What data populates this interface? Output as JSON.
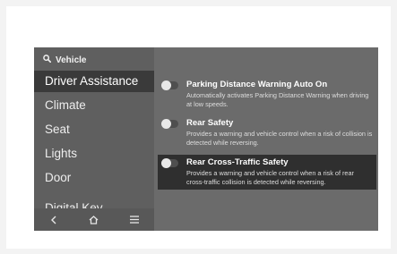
{
  "sidebar": {
    "header": {
      "icon": "search-icon",
      "label": "Vehicle"
    },
    "items": [
      {
        "label": "Driver Assistance",
        "active": true
      },
      {
        "label": "Climate"
      },
      {
        "label": "Seat"
      },
      {
        "label": "Lights"
      },
      {
        "label": "Door"
      },
      {
        "label": "Digital Key"
      }
    ],
    "bottom_bar": {
      "back_icon": "back-chevron-icon",
      "home_icon": "home-icon",
      "menu_icon": "menu-icon"
    }
  },
  "settings": [
    {
      "title": "Parking Distance Warning Auto On",
      "description": "Automatically activates Parking Distance Warning when driving at low speeds.",
      "enabled": false
    },
    {
      "title": "Rear Safety",
      "description": "Provides a warning and vehicle control when a risk of collision is detected while reversing.",
      "enabled": false
    },
    {
      "title": "Rear Cross-Traffic Safety",
      "description": "Provides a warning and vehicle control when a risk of rear cross-traffic collision is detected while reversing.",
      "enabled": false,
      "selected": true
    }
  ],
  "colors": {
    "screen_bg": "#6b6b6b",
    "sidebar_bg": "#5f5f5f",
    "active_item_bg": "#3a3a3a",
    "selected_setting_bg": "#2f2f2f"
  }
}
